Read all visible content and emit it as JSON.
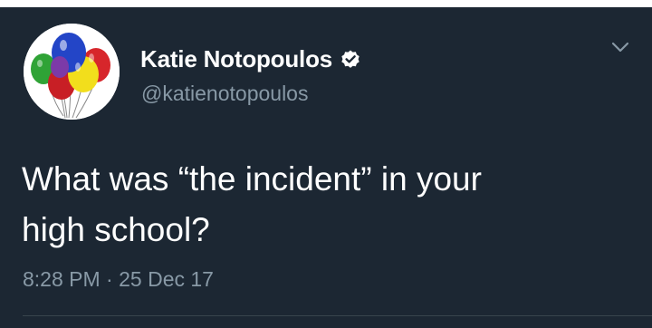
{
  "tweet": {
    "author": {
      "display_name": "Katie Notopoulos",
      "handle": "@katienotopoulos",
      "verified": true,
      "avatar": "balloons-image"
    },
    "text": "What was “the incident” in your\nhigh school?",
    "time": "8:28 PM",
    "separator": " · ",
    "date": "25 Dec 17",
    "menu_icon": "chevron-down-icon"
  },
  "colors": {
    "background": "#1c2733",
    "text_primary": "#ffffff",
    "text_secondary": "#8899a6",
    "verified_badge": "#ffffff"
  }
}
